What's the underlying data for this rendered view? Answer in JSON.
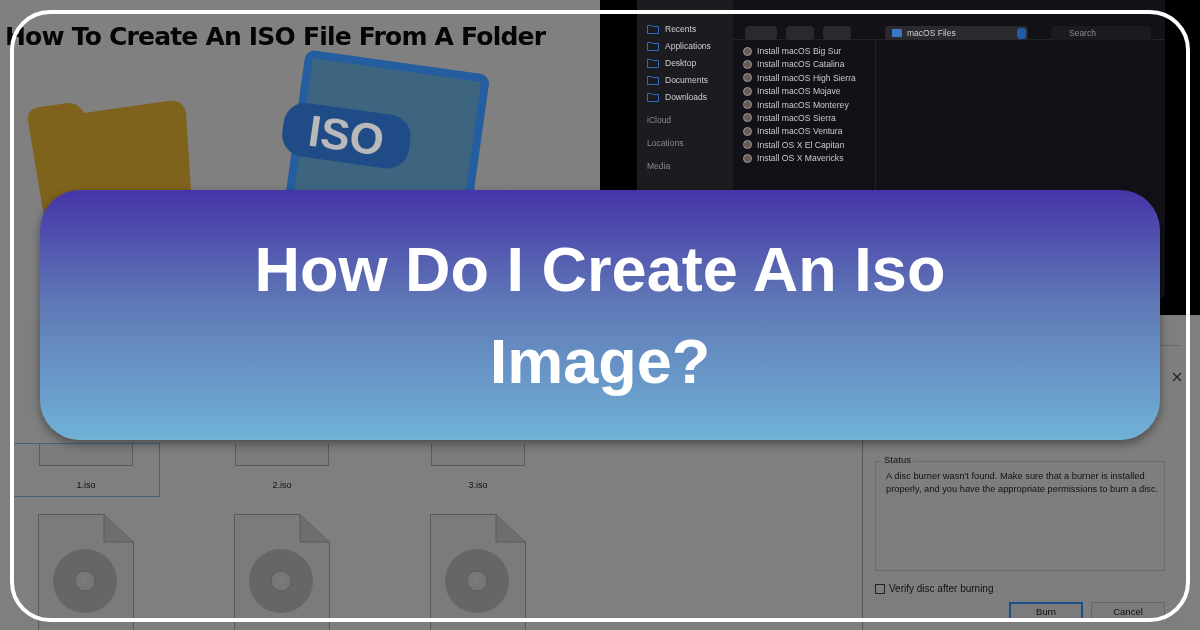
{
  "article": {
    "heading": "How To Create An ISO File From A Folder",
    "iso_badge": "ISO"
  },
  "finder": {
    "sidebar": [
      {
        "kind": "item",
        "label": "Recents"
      },
      {
        "kind": "item",
        "label": "Applications"
      },
      {
        "kind": "item",
        "label": "Desktop"
      },
      {
        "kind": "item",
        "label": "Documents"
      },
      {
        "kind": "item",
        "label": "Downloads"
      },
      {
        "kind": "section",
        "label": "iCloud"
      },
      {
        "kind": "section",
        "label": "Locations"
      },
      {
        "kind": "section",
        "label": "Media"
      }
    ],
    "path": "macOS Files",
    "search": {
      "placeholder": "Search"
    },
    "files": [
      "Install macOS Big Sur",
      "Install macOS Catalina",
      "Install macOS High Sierra",
      "Install macOS Mojave",
      "Install macOS Monterey",
      "Install macOS Sierra",
      "Install macOS Ventura",
      "Install OS X El Capitan",
      "Install OS X Mavericks"
    ]
  },
  "explorer": {
    "files": [
      {
        "name": "1.iso",
        "selected": true
      },
      {
        "name": "2.iso",
        "selected": false
      },
      {
        "name": "3.iso",
        "selected": false
      }
    ]
  },
  "dialog": {
    "status_label": "Status",
    "status_text": "A disc burner wasn't found. Make sure that a burner is installed properly, and you have the appropriate permissions to burn a disc.",
    "verify": {
      "label": "Verify disc after burning",
      "checked": false
    },
    "buttons": [
      "Burn",
      "Cancel"
    ]
  },
  "banner": {
    "title": "How Do I Create An Iso Image?"
  }
}
